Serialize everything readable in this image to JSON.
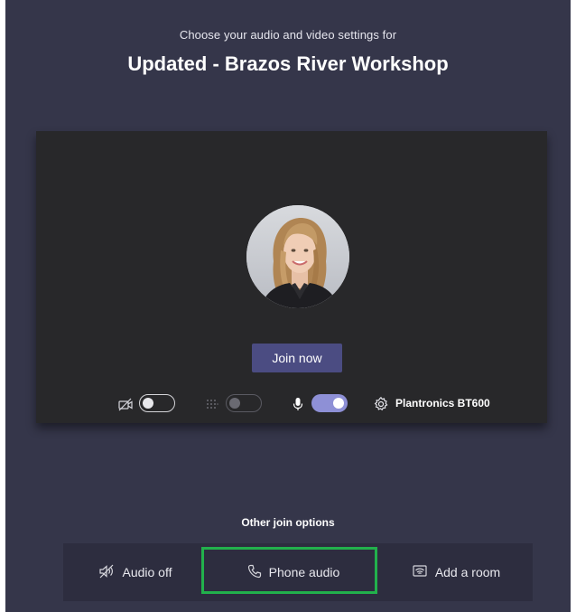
{
  "header": {
    "subtitle": "Choose your audio and video settings for",
    "meeting_title": "Updated - Brazos River Workshop"
  },
  "preview": {
    "join_button_label": "Join now",
    "controls": {
      "camera": {
        "icon": "camera-off-icon",
        "state": "off"
      },
      "background_blur": {
        "icon": "background-blur-icon",
        "state": "off",
        "enabled": false
      },
      "microphone": {
        "icon": "microphone-icon",
        "state": "on"
      },
      "device": {
        "icon": "gear-icon",
        "label": "Plantronics BT600"
      }
    }
  },
  "other_options": {
    "heading": "Other join options",
    "items": [
      {
        "icon": "speaker-off-icon",
        "label": "Audio off"
      },
      {
        "icon": "phone-icon",
        "label": "Phone audio"
      },
      {
        "icon": "cast-room-icon",
        "label": "Add a room"
      }
    ],
    "highlighted": "Phone audio"
  },
  "colors": {
    "background": "#35364a",
    "preview_background": "#28282a",
    "accent": "#4b4c82",
    "toggle_on": "#8e90d6",
    "highlight_box": "#22b14c"
  }
}
